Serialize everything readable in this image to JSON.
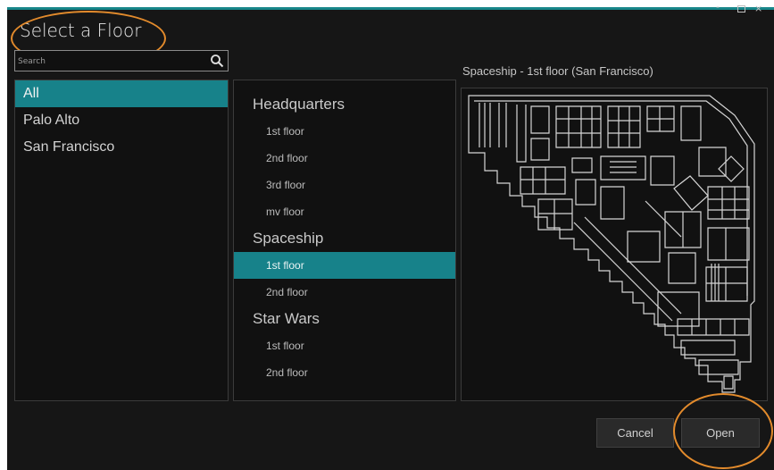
{
  "dialog": {
    "title": "Select a Floor",
    "window_controls": {
      "minimize": "-",
      "close": "×"
    }
  },
  "search": {
    "placeholder": "Search",
    "value": ""
  },
  "locations": [
    {
      "label": "All",
      "selected": true
    },
    {
      "label": "Palo Alto",
      "selected": false
    },
    {
      "label": "San Francisco",
      "selected": false
    }
  ],
  "floor_groups": [
    {
      "name": "Headquarters",
      "floors": [
        "1st floor",
        "2nd floor",
        "3rd floor",
        "mv floor"
      ]
    },
    {
      "name": "Spaceship",
      "floors": [
        "1st floor",
        "2nd floor"
      ]
    },
    {
      "name": "Star Wars",
      "floors": [
        "1st floor",
        "2nd floor"
      ]
    }
  ],
  "selected_floor": {
    "group": "Spaceship",
    "floor": "1st floor"
  },
  "preview": {
    "title": "Spaceship - 1st floor (San Francisco)"
  },
  "buttons": {
    "cancel": "Cancel",
    "open": "Open"
  },
  "colors": {
    "accent": "#17828a",
    "background": "#161616",
    "annotation": "#e38b2c"
  }
}
